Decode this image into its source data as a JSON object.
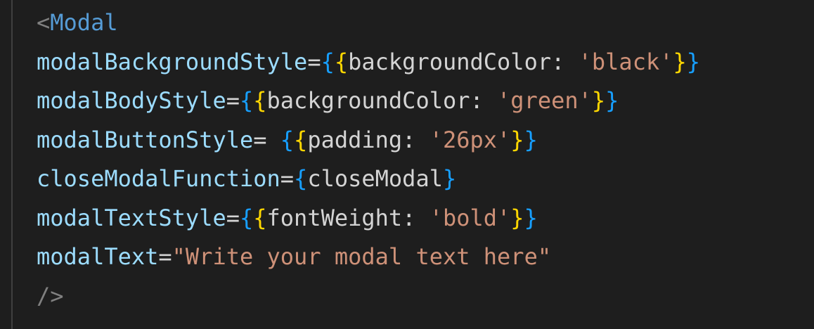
{
  "colors": {
    "background": "#1e1e1e",
    "tag_name": "#569cd6",
    "attribute": "#9cdcfe",
    "string": "#ce9178",
    "brace_outer": "#179fff",
    "brace_inner": "#ffd700",
    "plain_text": "#d4d4d4",
    "tag_punctuation": "#808080"
  },
  "code": {
    "open_bracket": "<",
    "tag_name": "Modal",
    "lines": [
      {
        "attr": "modalBackgroundStyle",
        "eq": "=",
        "key": "backgroundColor",
        "colon": ": ",
        "value": "'black'"
      },
      {
        "attr": "modalBodyStyle",
        "eq": "=",
        "key": "backgroundColor",
        "colon": ": ",
        "value": "'green'"
      },
      {
        "attr": "modalButtonStyle",
        "eq": "= ",
        "key": "padding",
        "colon": ": ",
        "value": "'26px'"
      },
      {
        "attr": "closeModalFunction",
        "eq": "=",
        "expr": "closeModal"
      },
      {
        "attr": "modalTextStyle",
        "eq": "=",
        "key": "fontWeight",
        "colon": ": ",
        "value": "'bold'"
      },
      {
        "attr": "modalText",
        "eq": "=",
        "string": "\"Write your modal text here\""
      }
    ],
    "self_close": "/>",
    "brace_open": "{",
    "brace_close": "}"
  }
}
